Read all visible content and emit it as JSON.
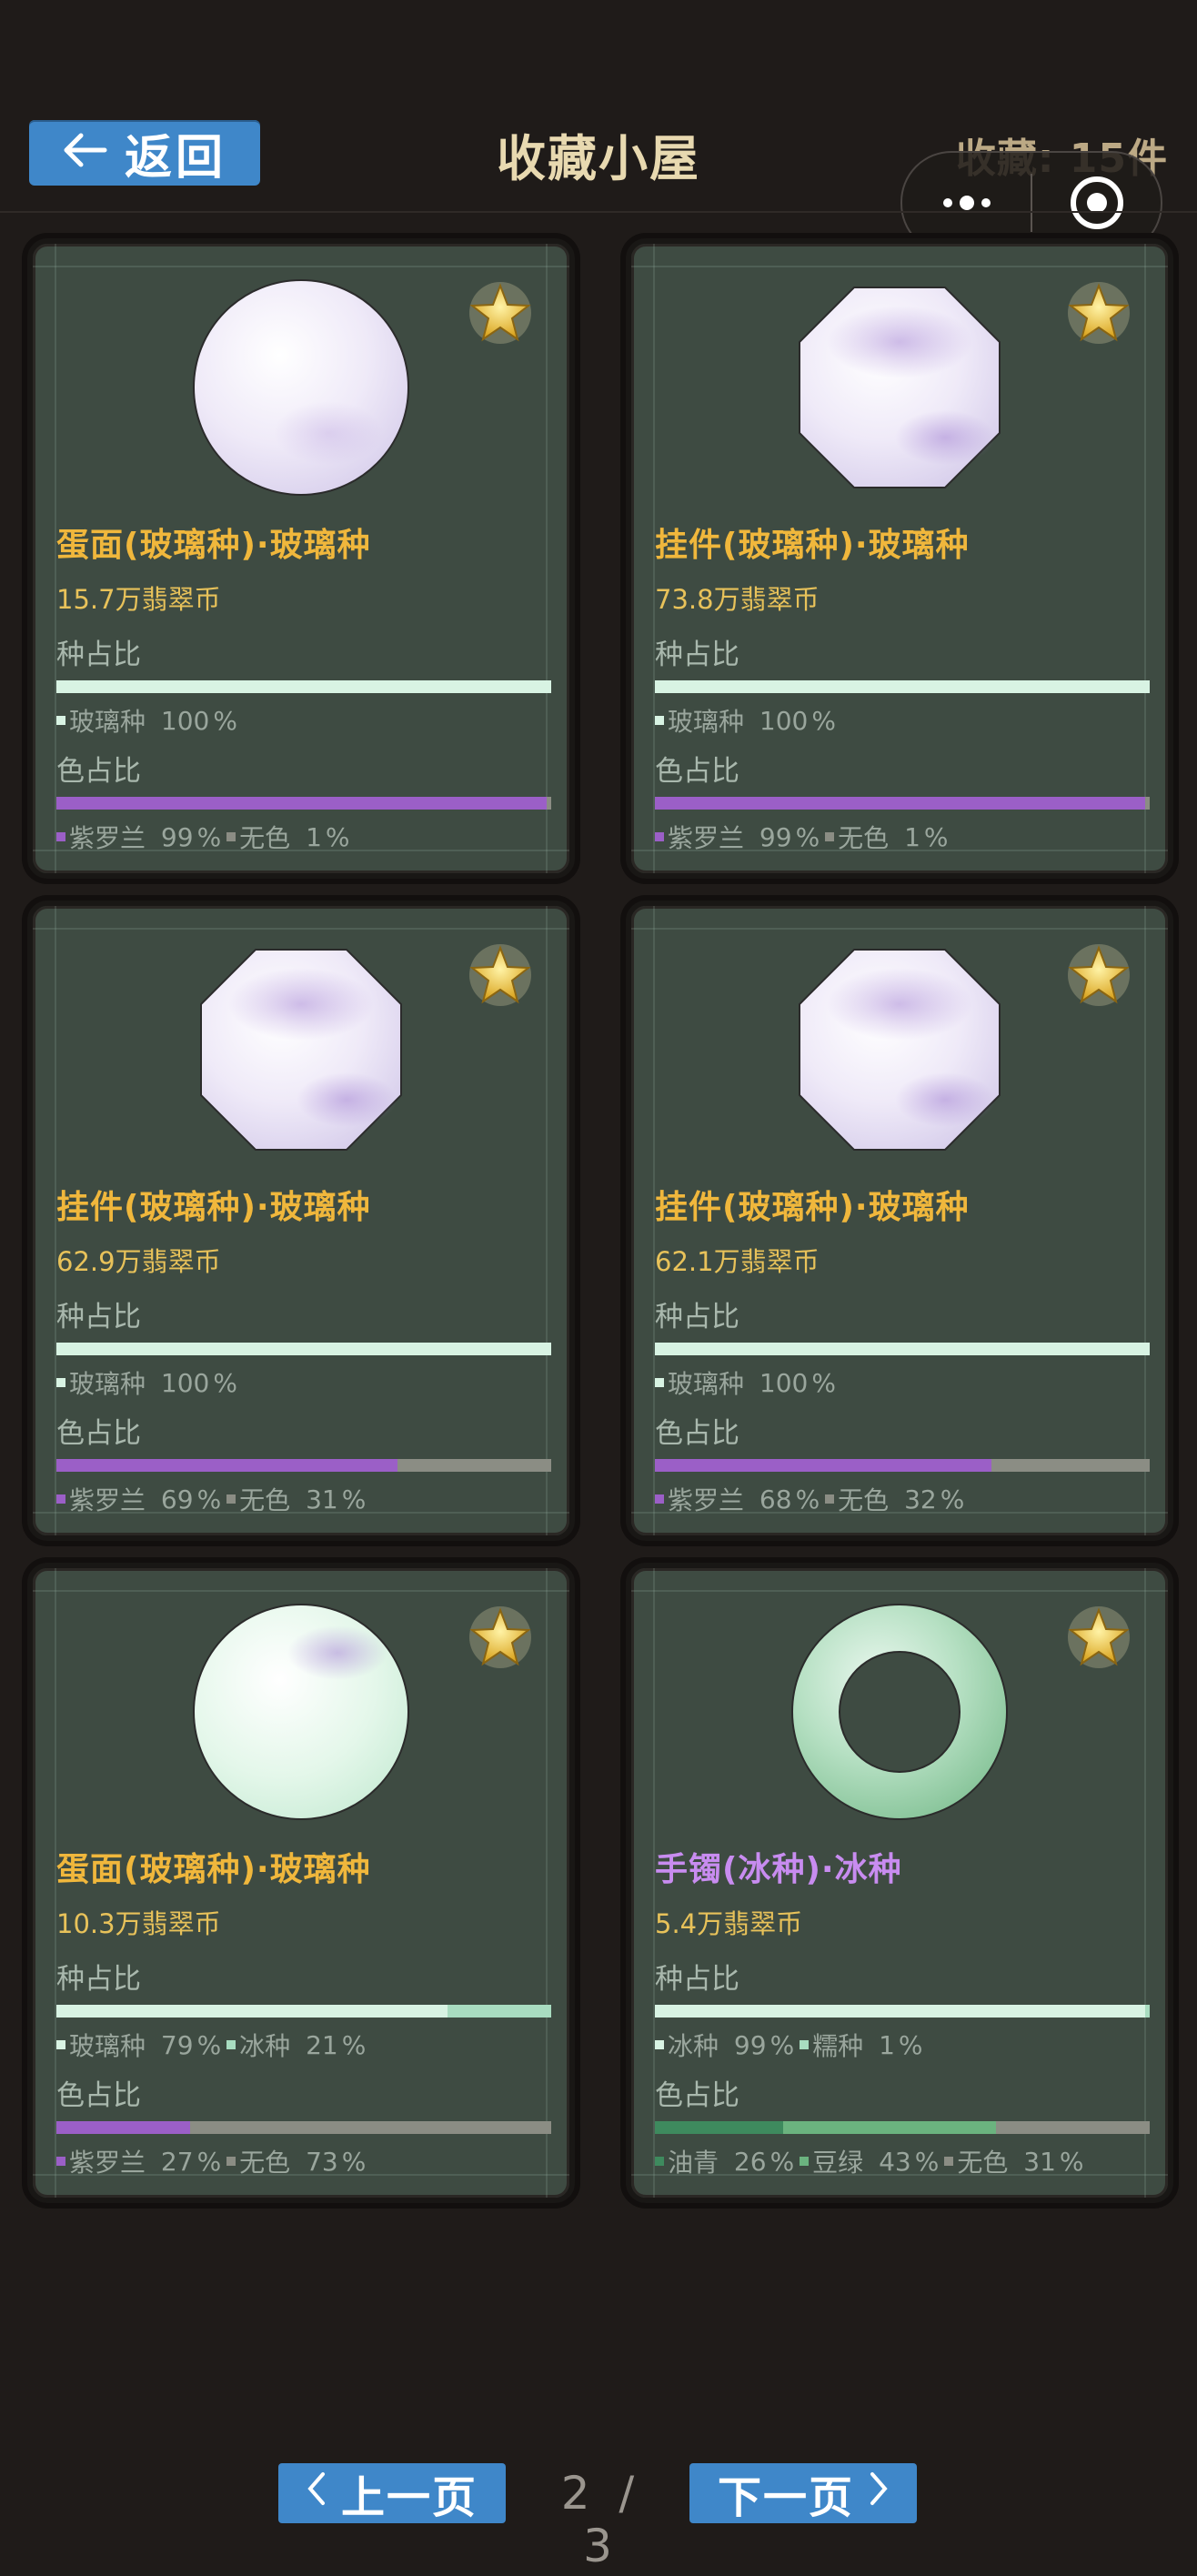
{
  "header": {
    "back_label": "返回",
    "title": "收藏小屋",
    "count_text": "收藏: 15件"
  },
  "colors": {
    "glass": "#d8f3e3",
    "ice": "#d8f3e3",
    "violet": "#9b5fc7",
    "colorless": "#8b8d84",
    "youqing": "#3e8a5e",
    "douLv": "#6bb37f",
    "name_gold": "#f0b73c",
    "name_violet": "#c88cf0"
  },
  "cards": [
    {
      "shape": "circle",
      "jade": "violet",
      "name": "蛋面(玻璃种)·玻璃种",
      "name_color": "#f0b73c",
      "price": "15.7万翡翠币",
      "seed_label": "种占比",
      "seed": [
        {
          "label": "玻璃种",
          "pct": 100,
          "color": "#d8f3e3"
        }
      ],
      "color_label": "色占比",
      "colorshare": [
        {
          "label": "紫罗兰",
          "pct": 99,
          "color": "#9b5fc7"
        },
        {
          "label": "无色",
          "pct": 1,
          "color": "#8b8d84"
        }
      ]
    },
    {
      "shape": "octagon",
      "jade": "violet",
      "name": "挂件(玻璃种)·玻璃种",
      "name_color": "#f0b73c",
      "price": "73.8万翡翠币",
      "seed_label": "种占比",
      "seed": [
        {
          "label": "玻璃种",
          "pct": 100,
          "color": "#d8f3e3"
        }
      ],
      "color_label": "色占比",
      "colorshare": [
        {
          "label": "紫罗兰",
          "pct": 99,
          "color": "#9b5fc7"
        },
        {
          "label": "无色",
          "pct": 1,
          "color": "#8b8d84"
        }
      ]
    },
    {
      "shape": "octagon",
      "jade": "violet",
      "name": "挂件(玻璃种)·玻璃种",
      "name_color": "#f0b73c",
      "price": "62.9万翡翠币",
      "seed_label": "种占比",
      "seed": [
        {
          "label": "玻璃种",
          "pct": 100,
          "color": "#d8f3e3"
        }
      ],
      "color_label": "色占比",
      "colorshare": [
        {
          "label": "紫罗兰",
          "pct": 69,
          "color": "#9b5fc7"
        },
        {
          "label": "无色",
          "pct": 31,
          "color": "#8b8d84"
        }
      ]
    },
    {
      "shape": "octagon",
      "jade": "violet",
      "name": "挂件(玻璃种)·玻璃种",
      "name_color": "#f0b73c",
      "price": "62.1万翡翠币",
      "seed_label": "种占比",
      "seed": [
        {
          "label": "玻璃种",
          "pct": 100,
          "color": "#d8f3e3"
        }
      ],
      "color_label": "色占比",
      "colorshare": [
        {
          "label": "紫罗兰",
          "pct": 68,
          "color": "#9b5fc7"
        },
        {
          "label": "无色",
          "pct": 32,
          "color": "#8b8d84"
        }
      ]
    },
    {
      "shape": "circle",
      "jade": "green-violet",
      "name": "蛋面(玻璃种)·玻璃种",
      "name_color": "#f0b73c",
      "price": "10.3万翡翠币",
      "seed_label": "种占比",
      "seed": [
        {
          "label": "玻璃种",
          "pct": 79,
          "color": "#d8f3e3"
        },
        {
          "label": "冰种",
          "pct": 21,
          "color": "#a8dcc0"
        }
      ],
      "color_label": "色占比",
      "colorshare": [
        {
          "label": "紫罗兰",
          "pct": 27,
          "color": "#9b5fc7"
        },
        {
          "label": "无色",
          "pct": 73,
          "color": "#8b8d84"
        }
      ]
    },
    {
      "shape": "ring",
      "jade": "green",
      "name": "手镯(冰种)·冰种",
      "name_color": "#c88cf0",
      "price": "5.4万翡翠币",
      "seed_label": "种占比",
      "seed": [
        {
          "label": "冰种",
          "pct": 99,
          "color": "#d8f3e3"
        },
        {
          "label": "糯种",
          "pct": 1,
          "color": "#a8dcc0"
        }
      ],
      "color_label": "色占比",
      "colorshare": [
        {
          "label": "油青",
          "pct": 26,
          "color": "#3e8a5e"
        },
        {
          "label": "豆绿",
          "pct": 43,
          "color": "#6bb37f"
        },
        {
          "label": "无色",
          "pct": 31,
          "color": "#8b8d84"
        }
      ]
    }
  ],
  "pager": {
    "prev_label": "上一页",
    "next_label": "下一页",
    "current": "2",
    "separator": "/",
    "total": "3"
  },
  "icons": {
    "back": "arrow-left-icon",
    "favorite": "star-icon",
    "more": "more-dots-icon",
    "close": "target-circle-icon",
    "prev": "chevron-left-icon",
    "next": "chevron-right-icon"
  }
}
